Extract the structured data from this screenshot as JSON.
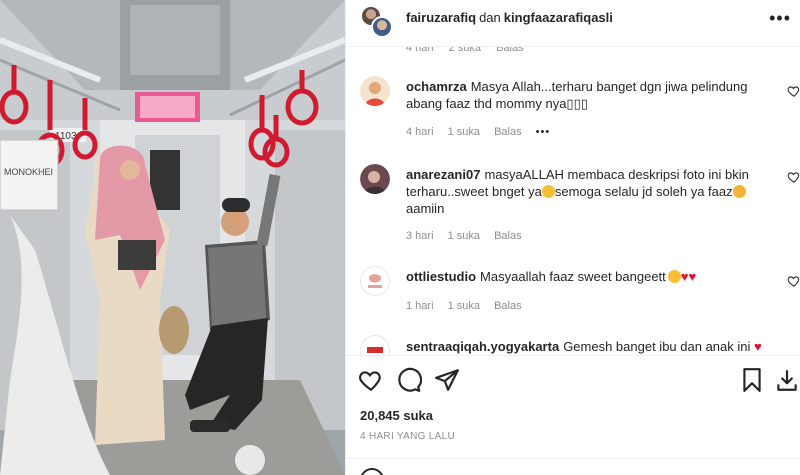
{
  "post": {
    "image_alt": "Mother in pink hijab and boy posing inside a train carriage",
    "train_number": "1103",
    "shop_sign": "MONOKHEI",
    "header": {
      "user1": "fairuzarafiq",
      "separator": "dan",
      "user2": "kingfaazarafiqasli"
    },
    "partial_meta": {
      "time": "4 hari",
      "likes": "2 suka",
      "reply": "Balas"
    },
    "comments": [
      {
        "username": "ochamrza",
        "text": "Masya Allah...terharu banget dgn jiwa pelindung abang faaz thd mommy nya▯▯▯",
        "time": "4 hari",
        "likes": "1 suka",
        "reply": "Balas",
        "more": "•••"
      },
      {
        "username": "anarezani07",
        "text_a": "masyaALLAH membaca deskripsi foto ini bkin terharu..sweet bnget ya",
        "text_b": "semoga selalu jd soleh ya faaz",
        "text_c": "aamiin",
        "time": "3 hari",
        "likes": "1 suka",
        "reply": "Balas"
      },
      {
        "username": "ottliestudio",
        "text": "Masyaallah faaz sweet bangeett",
        "time": "1 hari",
        "likes": "1 suka",
        "reply": "Balas"
      },
      {
        "username": "sentraaqiqah.yogyakarta",
        "text": "Gemesh banget ibu dan anak ini"
      }
    ],
    "likes_count": "20,845 suka",
    "posted": "4 HARI YANG LALU"
  },
  "colors": {
    "text": "#262626",
    "muted": "#8e8e8e",
    "border": "#efefef",
    "heart_red": "#e0142b",
    "hijab_pink": "#e49aa6",
    "strap_red": "#d01a30"
  },
  "icons": {
    "more": "more-horizontal-icon",
    "like": "heart-outline-icon",
    "comment": "comment-bubble-icon",
    "share": "paper-plane-icon",
    "save": "bookmark-icon",
    "download": "download-icon"
  }
}
